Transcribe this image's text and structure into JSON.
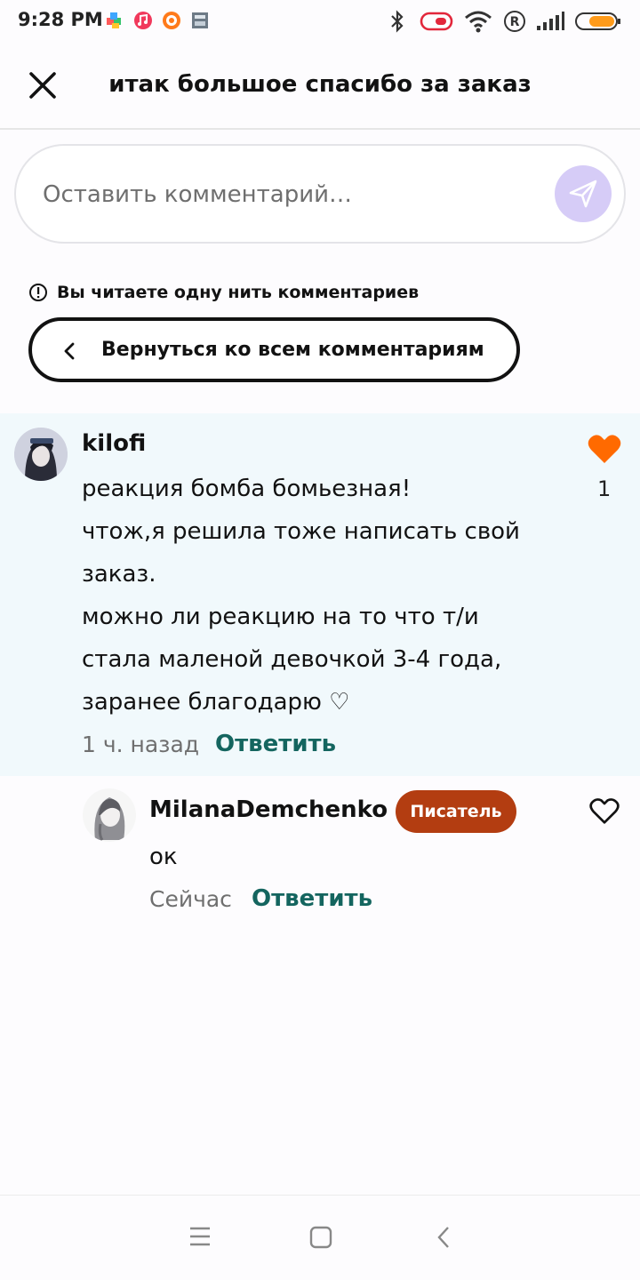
{
  "status_bar": {
    "time": "9:28 PM",
    "icons": [
      "app-icon-puzzle",
      "music-icon",
      "shop-icon",
      "calculator-icon",
      "bluetooth-icon",
      "alarm-icon",
      "wifi-icon",
      "roaming-r-icon",
      "signal-icon",
      "battery-icon"
    ],
    "roaming": "R"
  },
  "header": {
    "title": "итак большое спасибо за заказ"
  },
  "comment_input": {
    "placeholder": "Оставить комментарий…",
    "value": ""
  },
  "thread_notice": {
    "text": "Вы читаете одну нить комментариев",
    "back_label": "Вернуться ко всем комментариям"
  },
  "main_comment": {
    "author": "kilofi",
    "lines": [
      "реакция бомба бомьезная!",
      "чтож,я решила тоже написать свой",
      "заказ.",
      "можно ли реакцию на то что т/и",
      "стала маленой девочкой 3-4 года,",
      "заранее благодарю ♡"
    ],
    "time": "1 ч. назад",
    "reply_label": "Ответить",
    "likes": "1",
    "liked": true
  },
  "reply_comment": {
    "author": "MilanaDemchenko",
    "badge": "Писатель",
    "text": "ок",
    "time": "Сейчас",
    "reply_label": "Ответить",
    "liked": false
  },
  "colors": {
    "accent_like": "#ff6a00",
    "reply_link": "#14655f",
    "badge_bg": "#b33d11",
    "send_btn": "#d6ccf7",
    "main_comment_bg": "#f1f9fc"
  }
}
